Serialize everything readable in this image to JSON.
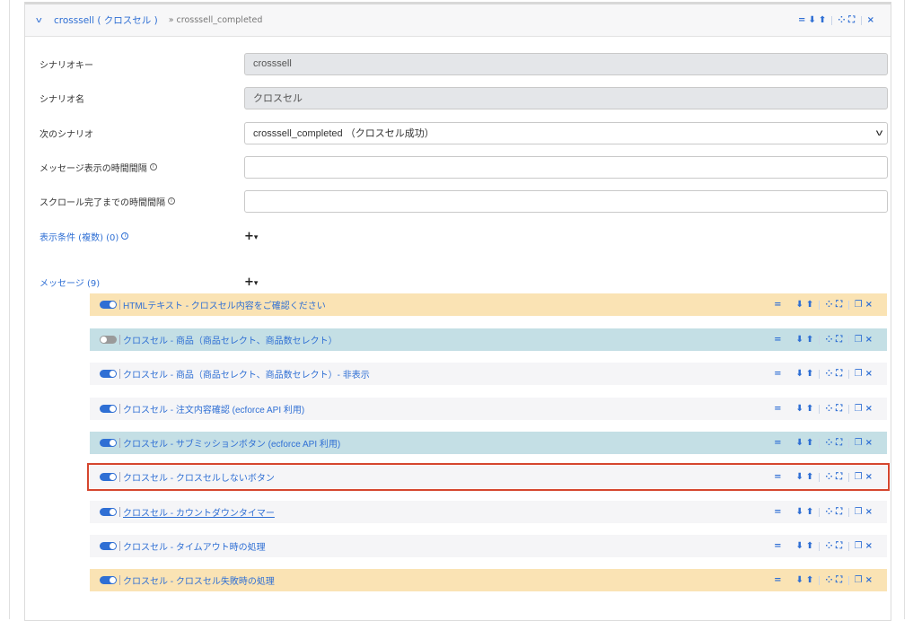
{
  "scenario": {
    "header": {
      "title": "crosssell ( クロスセル )",
      "subtitle": "» crosssell_completed"
    },
    "header_tools": [
      "=",
      "⬇",
      "⬆",
      "⁘",
      "⛶",
      "×"
    ],
    "fields": {
      "key_label": "シナリオキー",
      "key_value": "crosssell",
      "name_label": "シナリオ名",
      "name_value": "クロスセル",
      "next_label": "次のシナリオ",
      "next_value": "crosssell_completed （クロスセル成功）",
      "interval_label": "メッセージ表示の時間間隔",
      "interval_value": "",
      "scroll_label": "スクロール完了までの時間間隔",
      "scroll_value": ""
    },
    "conditions": {
      "label": "表示条件 (複数) (0)",
      "add": "+",
      "add_caret": "▾"
    },
    "messages_section": {
      "label": "メッセージ (9)",
      "add": "+",
      "add_caret": "▾"
    },
    "messages": [
      {
        "label": "HTMLテキスト - クロスセル内容をご確認ください",
        "color": "yellow",
        "enabled": true
      },
      {
        "label": "クロスセル - 商品（商品セレクト、商品数セレクト）",
        "color": "teal",
        "enabled": false
      },
      {
        "label": "クロスセル - 商品（商品セレクト、商品数セレクト）- 非表示",
        "color": "plain",
        "enabled": true
      },
      {
        "label": "クロスセル - 注文内容確認 (ecforce API 利用)",
        "color": "plain",
        "enabled": true
      },
      {
        "label": "クロスセル - サブミッションボタン (ecforce API 利用)",
        "color": "teal",
        "enabled": true
      },
      {
        "label": "クロスセル - クロスセルしないボタン",
        "color": "selected",
        "enabled": true
      },
      {
        "label": "クロスセル - カウントダウンタイマー",
        "color": "plain",
        "enabled": true
      },
      {
        "label": "クロスセル - タイムアウト時の処理",
        "color": "plain",
        "enabled": true
      },
      {
        "label": "クロスセル - クロスセル失敗時の処理",
        "color": "yellow",
        "enabled": true
      }
    ]
  },
  "colors": {
    "accent": "#2f6fd4",
    "yellow": "#fae3b4",
    "teal": "#c4dfe5",
    "selected_border": "#d5462e"
  }
}
